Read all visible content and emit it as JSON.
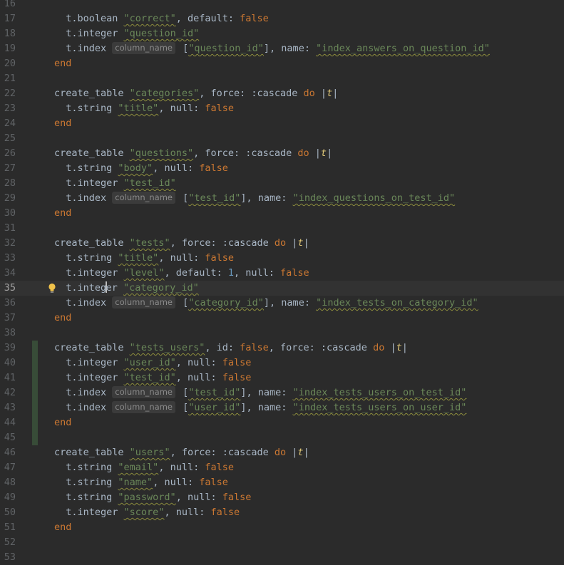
{
  "editor": {
    "lines": [
      {
        "n": "16",
        "tokens": []
      },
      {
        "n": "17",
        "tokens": [
          [
            "t",
            "  t.boolean "
          ],
          [
            "s",
            "\"correct\""
          ],
          [
            "t",
            ", default: "
          ],
          [
            "k",
            "false"
          ]
        ]
      },
      {
        "n": "18",
        "tokens": [
          [
            "t",
            "  t.integer "
          ],
          [
            "s",
            "\"question_id\""
          ]
        ]
      },
      {
        "n": "19",
        "tokens": [
          [
            "t",
            "  t.index "
          ],
          [
            "h",
            "column_name"
          ],
          [
            "t",
            " ["
          ],
          [
            "s",
            "\"question_id\""
          ],
          [
            "t",
            "], name: "
          ],
          [
            "s",
            "\"index_answers_on_question_id\""
          ]
        ]
      },
      {
        "n": "20",
        "tokens": [
          [
            "k",
            "end"
          ]
        ]
      },
      {
        "n": "21",
        "tokens": []
      },
      {
        "n": "22",
        "tokens": [
          [
            "t",
            "create_table "
          ],
          [
            "s",
            "\"categories\""
          ],
          [
            "t",
            ", force: :cascade "
          ],
          [
            "k",
            "do"
          ],
          [
            "t",
            " |"
          ],
          [
            "b",
            "t"
          ],
          [
            "t",
            "|"
          ]
        ]
      },
      {
        "n": "23",
        "tokens": [
          [
            "t",
            "  t.string "
          ],
          [
            "s",
            "\"title\""
          ],
          [
            "t",
            ", null: "
          ],
          [
            "k",
            "false"
          ]
        ]
      },
      {
        "n": "24",
        "tokens": [
          [
            "k",
            "end"
          ]
        ]
      },
      {
        "n": "25",
        "tokens": []
      },
      {
        "n": "26",
        "tokens": [
          [
            "t",
            "create_table "
          ],
          [
            "s",
            "\"questions\""
          ],
          [
            "t",
            ", force: :cascade "
          ],
          [
            "k",
            "do"
          ],
          [
            "t",
            " |"
          ],
          [
            "b",
            "t"
          ],
          [
            "t",
            "|"
          ]
        ]
      },
      {
        "n": "27",
        "tokens": [
          [
            "t",
            "  t.string "
          ],
          [
            "s",
            "\"body\""
          ],
          [
            "t",
            ", null: "
          ],
          [
            "k",
            "false"
          ]
        ]
      },
      {
        "n": "28",
        "tokens": [
          [
            "t",
            "  t.integer "
          ],
          [
            "s",
            "\"test_id\""
          ]
        ]
      },
      {
        "n": "29",
        "tokens": [
          [
            "t",
            "  t.index "
          ],
          [
            "h",
            "column_name"
          ],
          [
            "t",
            " ["
          ],
          [
            "s",
            "\"test_id\""
          ],
          [
            "t",
            "], name: "
          ],
          [
            "s",
            "\"index_questions_on_test_id\""
          ]
        ]
      },
      {
        "n": "30",
        "tokens": [
          [
            "k",
            "end"
          ]
        ]
      },
      {
        "n": "31",
        "tokens": []
      },
      {
        "n": "32",
        "tokens": [
          [
            "t",
            "create_table "
          ],
          [
            "s",
            "\"tests\""
          ],
          [
            "t",
            ", force: :cascade "
          ],
          [
            "k",
            "do"
          ],
          [
            "t",
            " |"
          ],
          [
            "b",
            "t"
          ],
          [
            "t",
            "|"
          ]
        ]
      },
      {
        "n": "33",
        "tokens": [
          [
            "t",
            "  t.string "
          ],
          [
            "s",
            "\"title\""
          ],
          [
            "t",
            ", null: "
          ],
          [
            "k",
            "false"
          ]
        ]
      },
      {
        "n": "34",
        "tokens": [
          [
            "t",
            "  t.integer "
          ],
          [
            "s",
            "\"level\""
          ],
          [
            "t",
            ", default: "
          ],
          [
            "n",
            "1"
          ],
          [
            "t",
            ", null: "
          ],
          [
            "k",
            "false"
          ]
        ]
      },
      {
        "n": "35",
        "current": true,
        "bulb": true,
        "tokens": [
          [
            "t",
            "  t.integ"
          ],
          [
            "c",
            ""
          ],
          [
            "t",
            "er "
          ],
          [
            "s",
            "\"category_id\""
          ]
        ]
      },
      {
        "n": "36",
        "tokens": [
          [
            "t",
            "  t.index "
          ],
          [
            "h",
            "column_name"
          ],
          [
            "t",
            " ["
          ],
          [
            "s",
            "\"category_id\""
          ],
          [
            "t",
            "], name: "
          ],
          [
            "s",
            "\"index_tests_on_category_id\""
          ]
        ]
      },
      {
        "n": "37",
        "tokens": [
          [
            "k",
            "end"
          ]
        ]
      },
      {
        "n": "38",
        "tokens": []
      },
      {
        "n": "39",
        "changed": true,
        "tokens": [
          [
            "t",
            "create_table "
          ],
          [
            "s",
            "\"tests_users\""
          ],
          [
            "t",
            ", id: "
          ],
          [
            "k",
            "false"
          ],
          [
            "t",
            ", force: :cascade "
          ],
          [
            "k",
            "do"
          ],
          [
            "t",
            " |"
          ],
          [
            "b",
            "t"
          ],
          [
            "t",
            "|"
          ]
        ]
      },
      {
        "n": "40",
        "changed": true,
        "tokens": [
          [
            "t",
            "  t.integer "
          ],
          [
            "s",
            "\"user_id\""
          ],
          [
            "t",
            ", null: "
          ],
          [
            "k",
            "false"
          ]
        ]
      },
      {
        "n": "41",
        "changed": true,
        "tokens": [
          [
            "t",
            "  t.integer "
          ],
          [
            "s",
            "\"test_id\""
          ],
          [
            "t",
            ", null: "
          ],
          [
            "k",
            "false"
          ]
        ]
      },
      {
        "n": "42",
        "changed": true,
        "tokens": [
          [
            "t",
            "  t.index "
          ],
          [
            "h",
            "column_name"
          ],
          [
            "t",
            " ["
          ],
          [
            "s",
            "\"test_id\""
          ],
          [
            "t",
            "], name: "
          ],
          [
            "s",
            "\"index_tests_users_on_test_id\""
          ]
        ]
      },
      {
        "n": "43",
        "changed": true,
        "tokens": [
          [
            "t",
            "  t.index "
          ],
          [
            "h",
            "column_name"
          ],
          [
            "t",
            " ["
          ],
          [
            "s",
            "\"user_id\""
          ],
          [
            "t",
            "], name: "
          ],
          [
            "s",
            "\"index_tests_users_on_user_id\""
          ]
        ]
      },
      {
        "n": "44",
        "changed": true,
        "tokens": [
          [
            "k",
            "end"
          ]
        ]
      },
      {
        "n": "45",
        "changed": true,
        "tokens": []
      },
      {
        "n": "46",
        "tokens": [
          [
            "t",
            "create_table "
          ],
          [
            "s",
            "\"users\""
          ],
          [
            "t",
            ", force: :cascade "
          ],
          [
            "k",
            "do"
          ],
          [
            "t",
            " |"
          ],
          [
            "b",
            "t"
          ],
          [
            "t",
            "|"
          ]
        ]
      },
      {
        "n": "47",
        "tokens": [
          [
            "t",
            "  t.string "
          ],
          [
            "s",
            "\"email\""
          ],
          [
            "t",
            ", null: "
          ],
          [
            "k",
            "false"
          ]
        ]
      },
      {
        "n": "48",
        "tokens": [
          [
            "t",
            "  t.string "
          ],
          [
            "s",
            "\"name\""
          ],
          [
            "t",
            ", null: "
          ],
          [
            "k",
            "false"
          ]
        ]
      },
      {
        "n": "49",
        "tokens": [
          [
            "t",
            "  t.string "
          ],
          [
            "s",
            "\"password\""
          ],
          [
            "t",
            ", null: "
          ],
          [
            "k",
            "false"
          ]
        ]
      },
      {
        "n": "50",
        "tokens": [
          [
            "t",
            "  t.integer "
          ],
          [
            "s",
            "\"score\""
          ],
          [
            "t",
            ", null: "
          ],
          [
            "k",
            "false"
          ]
        ]
      },
      {
        "n": "51",
        "tokens": [
          [
            "k",
            "end"
          ]
        ]
      },
      {
        "n": "52",
        "tokens": []
      },
      {
        "n": "53",
        "tokens": []
      }
    ]
  },
  "colors": {
    "background": "#2b2b2b",
    "keyword": "#cc7832",
    "string": "#6a8759",
    "number": "#6897bb",
    "line_number": "#606366",
    "changed_gutter": "#384c38"
  },
  "icons": {
    "intention_bulb": "lightbulb-icon"
  }
}
